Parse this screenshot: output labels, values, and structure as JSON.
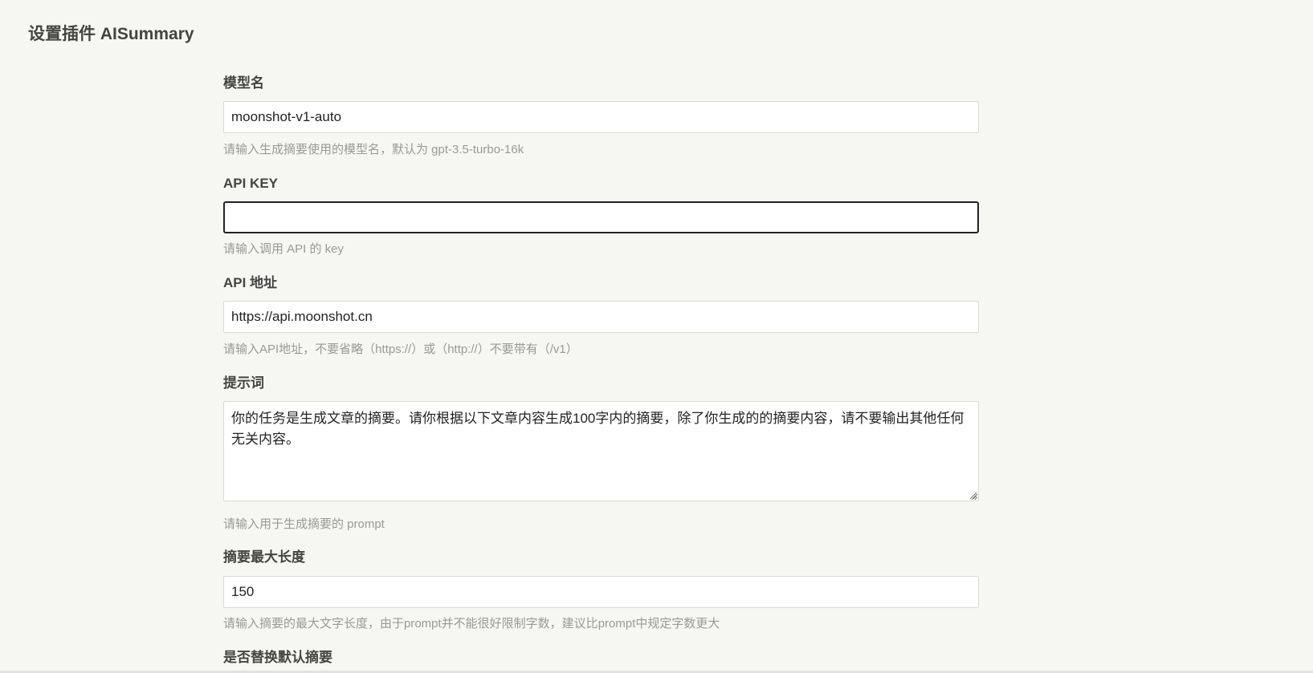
{
  "page": {
    "title": "设置插件 AISummary"
  },
  "fields": {
    "model": {
      "label": "模型名",
      "value": "moonshot-v1-auto",
      "help": "请输入生成摘要使用的模型名，默认为 gpt-3.5-turbo-16k"
    },
    "api_key": {
      "label": "API KEY",
      "value": "",
      "help": "请输入调用 API 的 key"
    },
    "api_url": {
      "label": "API 地址",
      "value": "https://api.moonshot.cn",
      "help": "请输入API地址，不要省略（https://）或（http://）不要带有（/v1）"
    },
    "prompt": {
      "label": "提示词",
      "value": "你的任务是生成文章的摘要。请你根据以下文章内容生成100字内的摘要，除了你生成的的摘要内容，请不要输出其他任何无关内容。",
      "help": "请输入用于生成摘要的 prompt"
    },
    "max_length": {
      "label": "摘要最大长度",
      "value": "150",
      "help": "请输入摘要的最大文字长度，由于prompt并不能很好限制字数，建议比prompt中规定字数更大"
    },
    "replace_default": {
      "label": "是否替换默认摘要"
    }
  },
  "colors": {
    "background": "#f6f6f3",
    "text": "#444444",
    "help_text": "#999999",
    "focus_border": "#222222"
  }
}
